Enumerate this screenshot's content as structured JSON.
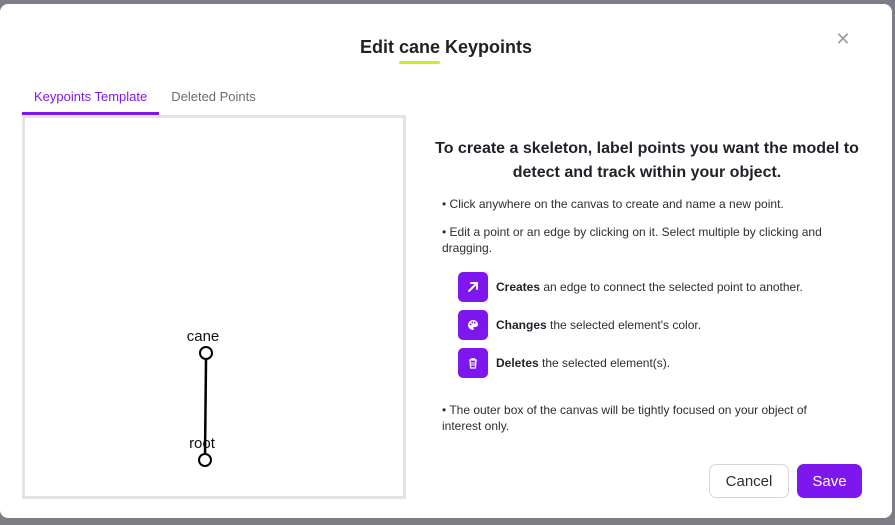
{
  "dialog": {
    "title_prefix": "Edit",
    "object_name": "cane",
    "title_suffix": "Keypoints",
    "close_icon": "close-icon"
  },
  "tabs": [
    {
      "label": "Keypoints Template",
      "active": true
    },
    {
      "label": "Deleted Points",
      "active": false
    }
  ],
  "canvas": {
    "keypoints": [
      {
        "label": "cane"
      },
      {
        "label": "root"
      }
    ]
  },
  "instructions": {
    "headline": "To create a skeleton, label points you want the model to detect and track within your object.",
    "bullet1": "• Click anywhere on the canvas to create and name a new point.",
    "bullet2": "• Edit a point or an edge by clicking on it. Select multiple by clicking and dragging.",
    "tools": [
      {
        "icon": "arrow-up-right-icon",
        "bold": "Creates",
        "text": " an edge to connect the selected point to another."
      },
      {
        "icon": "palette-icon",
        "bold": "Changes",
        "text": " the selected element's color."
      },
      {
        "icon": "trash-icon",
        "bold": "Deletes",
        "text": " the selected element(s)."
      }
    ],
    "bullet3": "• The outer box of the canvas will be tightly focused on your object of interest only."
  },
  "footer": {
    "cancel_label": "Cancel",
    "save_label": "Save"
  },
  "colors": {
    "accent": "#7e17ee",
    "highlight": "#c6ee28"
  }
}
